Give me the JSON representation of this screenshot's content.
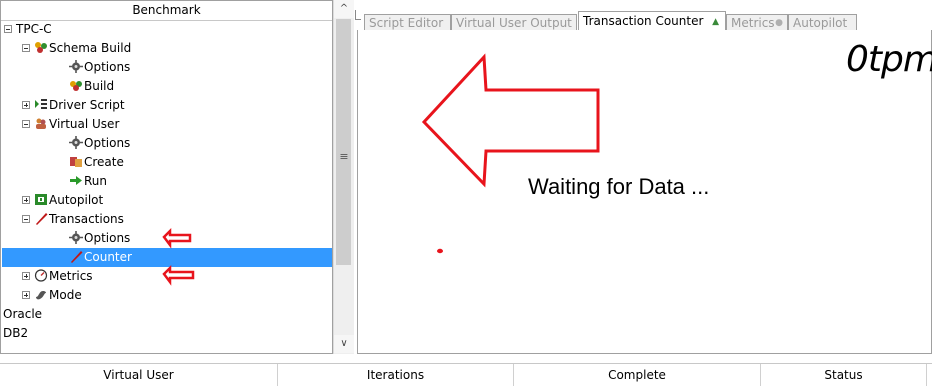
{
  "tree": {
    "header": "Benchmark",
    "items": [
      {
        "label": "TPC-C",
        "toggle": "minus",
        "icon": "none",
        "indent": 1
      },
      {
        "label": "Schema Build",
        "toggle": "minus",
        "icon": "schema-build-icon",
        "indent": 2
      },
      {
        "label": "Options",
        "toggle": "none",
        "icon": "options-icon",
        "indent": 3
      },
      {
        "label": "Build",
        "toggle": "none",
        "icon": "build-icon",
        "indent": 3
      },
      {
        "label": "Driver Script",
        "toggle": "plus",
        "icon": "driver-script-icon",
        "indent": 2
      },
      {
        "label": "Virtual User",
        "toggle": "minus",
        "icon": "virtual-user-icon",
        "indent": 2
      },
      {
        "label": "Options",
        "toggle": "none",
        "icon": "options-icon",
        "indent": 3
      },
      {
        "label": "Create",
        "toggle": "none",
        "icon": "create-icon",
        "indent": 3
      },
      {
        "label": "Run",
        "toggle": "none",
        "icon": "run-icon",
        "indent": 3
      },
      {
        "label": "Autopilot",
        "toggle": "plus",
        "icon": "autopilot-icon",
        "indent": 2
      },
      {
        "label": "Transactions",
        "toggle": "minus",
        "icon": "transactions-icon",
        "indent": 2
      },
      {
        "label": "Options",
        "toggle": "none",
        "icon": "options-icon",
        "indent": 3
      },
      {
        "label": "Counter",
        "toggle": "none",
        "icon": "counter-icon",
        "indent": 3,
        "selected": true
      },
      {
        "label": "Metrics",
        "toggle": "plus",
        "icon": "metrics-icon",
        "indent": 2
      },
      {
        "label": "Mode",
        "toggle": "plus",
        "icon": "mode-icon",
        "indent": 2
      },
      {
        "label": "Oracle",
        "toggle": "none",
        "icon": "none",
        "indent": 0
      },
      {
        "label": "DB2",
        "toggle": "none",
        "icon": "none",
        "indent": 0
      }
    ]
  },
  "tabs": [
    {
      "label": "Script Editor",
      "active": false
    },
    {
      "label": "Virtual User Output",
      "active": false
    },
    {
      "label": "Transaction Counter",
      "active": true
    },
    {
      "label": "Metrics",
      "active": false
    },
    {
      "label": "Autopilot",
      "active": false
    }
  ],
  "counter": {
    "tpm_text": "0tpm",
    "waiting_text": "Waiting for Data ..."
  },
  "bottom_columns": [
    "Virtual User",
    "Iterations",
    "Complete",
    "Status"
  ],
  "colors": {
    "selection": "#3399ff",
    "annotation": "#e8141c"
  }
}
